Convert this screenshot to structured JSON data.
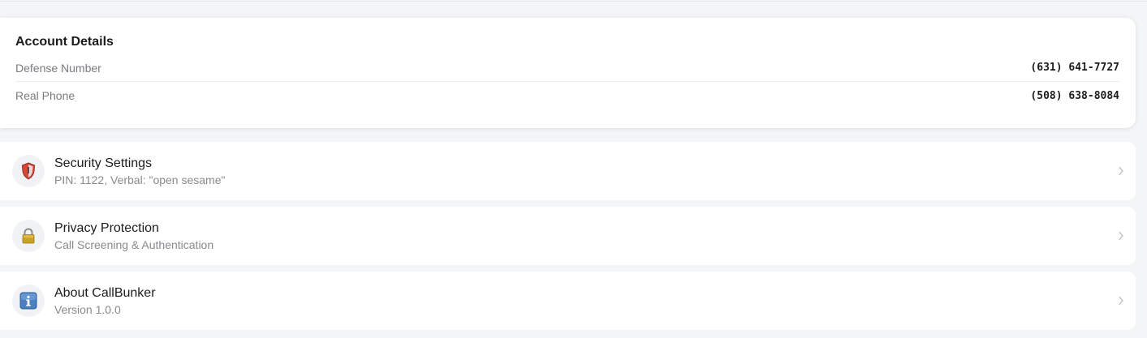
{
  "account": {
    "title": "Account Details",
    "rows": [
      {
        "label": "Defense Number",
        "value": "(631) 641-7727"
      },
      {
        "label": "Real Phone",
        "value": "(508) 638-8084"
      }
    ]
  },
  "menu": [
    {
      "icon": "shield-icon",
      "title": "Security Settings",
      "subtitle": "PIN: 1122, Verbal: \"open sesame\""
    },
    {
      "icon": "lock-icon",
      "title": "Privacy Protection",
      "subtitle": "Call Screening & Authentication"
    },
    {
      "icon": "info-icon",
      "title": "About CallBunker",
      "subtitle": "Version 1.0.0"
    }
  ],
  "colors": {
    "background": "#f4f5f7",
    "card": "#ffffff",
    "shield_red": "#d9473a",
    "lock_gold": "#c9a227",
    "info_blue": "#4a7fc1"
  }
}
